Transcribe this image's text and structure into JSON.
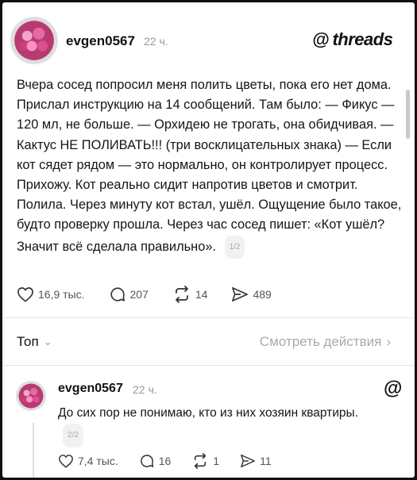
{
  "post": {
    "username": "evgen0567",
    "time": "22 ч.",
    "brand_icon": "@",
    "brand_word": "threads",
    "text": "Вчера сосед попросил меня полить цветы, пока его нет дома. Прислал инструкцию на 14 сообщений. Там было: — Фикус — 120 мл, не больше. — Орхидею не трогать, она обидчивая. — Кактус НЕ ПОЛИВАТЬ!!! (три восклицательных знака) — Если кот сядет рядом — это нормально, он контролирует процесс. Прихожу. Кот реально сидит напротив цветов и смотрит. Полила. Через минуту кот встал, ушёл. Ощущение было такое, будто проверку прошла. Через час сосед пишет: «Кот ушёл? Значит всё сделала правильно».",
    "page_indicator": "1/2",
    "likes": "16,9 тыс.",
    "comments": "207",
    "reposts": "14",
    "shares": "489"
  },
  "toolbar": {
    "sort_label": "Топ",
    "view_actions_label": "Смотреть действия"
  },
  "reply": {
    "username": "evgen0567",
    "time": "22 ч.",
    "brand_icon": "@",
    "text": "До сих пор не понимаю, кто из них хозяин квартиры.",
    "page_indicator": "2/2",
    "likes": "7,4 тыс.",
    "comments": "16",
    "reposts": "1",
    "shares": "11"
  },
  "icons": {
    "like": "heart-icon",
    "comment": "speech-bubble-icon",
    "repost": "repost-arrows-icon",
    "share": "paper-plane-icon"
  }
}
